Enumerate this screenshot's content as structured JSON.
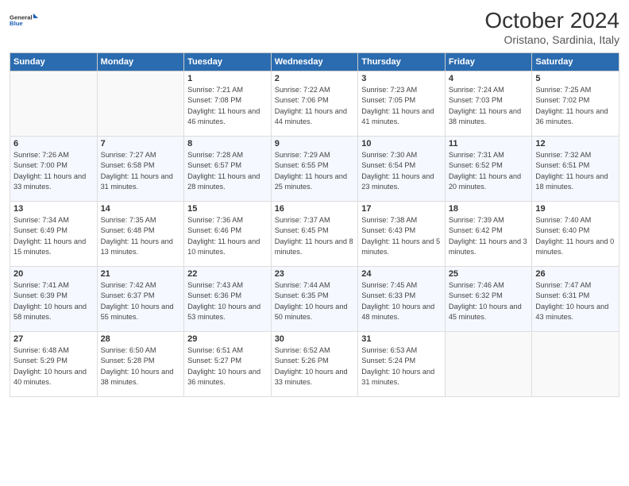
{
  "header": {
    "logo_line1": "General",
    "logo_line2": "Blue",
    "month_title": "October 2024",
    "subtitle": "Oristano, Sardinia, Italy"
  },
  "weekdays": [
    "Sunday",
    "Monday",
    "Tuesday",
    "Wednesday",
    "Thursday",
    "Friday",
    "Saturday"
  ],
  "weeks": [
    [
      {
        "day": "",
        "info": ""
      },
      {
        "day": "",
        "info": ""
      },
      {
        "day": "1",
        "info": "Sunrise: 7:21 AM\nSunset: 7:08 PM\nDaylight: 11 hours and 46 minutes."
      },
      {
        "day": "2",
        "info": "Sunrise: 7:22 AM\nSunset: 7:06 PM\nDaylight: 11 hours and 44 minutes."
      },
      {
        "day": "3",
        "info": "Sunrise: 7:23 AM\nSunset: 7:05 PM\nDaylight: 11 hours and 41 minutes."
      },
      {
        "day": "4",
        "info": "Sunrise: 7:24 AM\nSunset: 7:03 PM\nDaylight: 11 hours and 38 minutes."
      },
      {
        "day": "5",
        "info": "Sunrise: 7:25 AM\nSunset: 7:02 PM\nDaylight: 11 hours and 36 minutes."
      }
    ],
    [
      {
        "day": "6",
        "info": "Sunrise: 7:26 AM\nSunset: 7:00 PM\nDaylight: 11 hours and 33 minutes."
      },
      {
        "day": "7",
        "info": "Sunrise: 7:27 AM\nSunset: 6:58 PM\nDaylight: 11 hours and 31 minutes."
      },
      {
        "day": "8",
        "info": "Sunrise: 7:28 AM\nSunset: 6:57 PM\nDaylight: 11 hours and 28 minutes."
      },
      {
        "day": "9",
        "info": "Sunrise: 7:29 AM\nSunset: 6:55 PM\nDaylight: 11 hours and 25 minutes."
      },
      {
        "day": "10",
        "info": "Sunrise: 7:30 AM\nSunset: 6:54 PM\nDaylight: 11 hours and 23 minutes."
      },
      {
        "day": "11",
        "info": "Sunrise: 7:31 AM\nSunset: 6:52 PM\nDaylight: 11 hours and 20 minutes."
      },
      {
        "day": "12",
        "info": "Sunrise: 7:32 AM\nSunset: 6:51 PM\nDaylight: 11 hours and 18 minutes."
      }
    ],
    [
      {
        "day": "13",
        "info": "Sunrise: 7:34 AM\nSunset: 6:49 PM\nDaylight: 11 hours and 15 minutes."
      },
      {
        "day": "14",
        "info": "Sunrise: 7:35 AM\nSunset: 6:48 PM\nDaylight: 11 hours and 13 minutes."
      },
      {
        "day": "15",
        "info": "Sunrise: 7:36 AM\nSunset: 6:46 PM\nDaylight: 11 hours and 10 minutes."
      },
      {
        "day": "16",
        "info": "Sunrise: 7:37 AM\nSunset: 6:45 PM\nDaylight: 11 hours and 8 minutes."
      },
      {
        "day": "17",
        "info": "Sunrise: 7:38 AM\nSunset: 6:43 PM\nDaylight: 11 hours and 5 minutes."
      },
      {
        "day": "18",
        "info": "Sunrise: 7:39 AM\nSunset: 6:42 PM\nDaylight: 11 hours and 3 minutes."
      },
      {
        "day": "19",
        "info": "Sunrise: 7:40 AM\nSunset: 6:40 PM\nDaylight: 11 hours and 0 minutes."
      }
    ],
    [
      {
        "day": "20",
        "info": "Sunrise: 7:41 AM\nSunset: 6:39 PM\nDaylight: 10 hours and 58 minutes."
      },
      {
        "day": "21",
        "info": "Sunrise: 7:42 AM\nSunset: 6:37 PM\nDaylight: 10 hours and 55 minutes."
      },
      {
        "day": "22",
        "info": "Sunrise: 7:43 AM\nSunset: 6:36 PM\nDaylight: 10 hours and 53 minutes."
      },
      {
        "day": "23",
        "info": "Sunrise: 7:44 AM\nSunset: 6:35 PM\nDaylight: 10 hours and 50 minutes."
      },
      {
        "day": "24",
        "info": "Sunrise: 7:45 AM\nSunset: 6:33 PM\nDaylight: 10 hours and 48 minutes."
      },
      {
        "day": "25",
        "info": "Sunrise: 7:46 AM\nSunset: 6:32 PM\nDaylight: 10 hours and 45 minutes."
      },
      {
        "day": "26",
        "info": "Sunrise: 7:47 AM\nSunset: 6:31 PM\nDaylight: 10 hours and 43 minutes."
      }
    ],
    [
      {
        "day": "27",
        "info": "Sunrise: 6:48 AM\nSunset: 5:29 PM\nDaylight: 10 hours and 40 minutes."
      },
      {
        "day": "28",
        "info": "Sunrise: 6:50 AM\nSunset: 5:28 PM\nDaylight: 10 hours and 38 minutes."
      },
      {
        "day": "29",
        "info": "Sunrise: 6:51 AM\nSunset: 5:27 PM\nDaylight: 10 hours and 36 minutes."
      },
      {
        "day": "30",
        "info": "Sunrise: 6:52 AM\nSunset: 5:26 PM\nDaylight: 10 hours and 33 minutes."
      },
      {
        "day": "31",
        "info": "Sunrise: 6:53 AM\nSunset: 5:24 PM\nDaylight: 10 hours and 31 minutes."
      },
      {
        "day": "",
        "info": ""
      },
      {
        "day": "",
        "info": ""
      }
    ]
  ]
}
